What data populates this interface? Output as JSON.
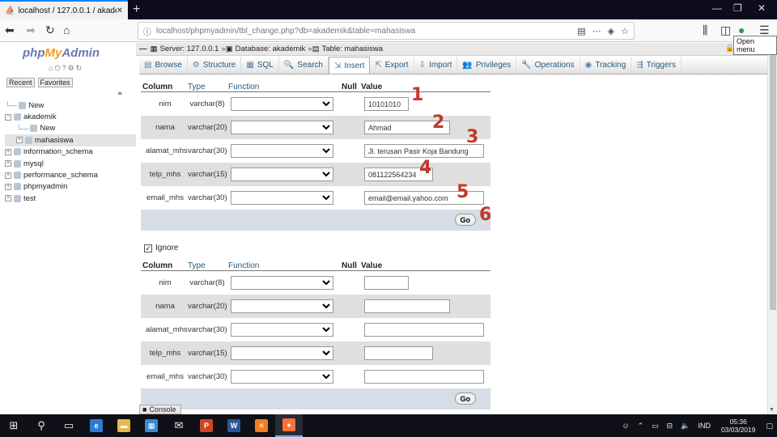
{
  "browser": {
    "tab_title": "localhost / 127.0.0.1 / akademik",
    "tab_close": "✕",
    "new_tab": "+",
    "url": "localhost/phpmyadmin/tbl_change.php?db=akademik&table=mahasiswa",
    "menu_tooltip": "Open menu"
  },
  "sidebar": {
    "logo_php": "php",
    "logo_my": "My",
    "logo_admin": "Admin",
    "tab_recent": "Recent",
    "tab_favorites": "Favorites",
    "tree": [
      {
        "label": "New",
        "level": 0,
        "toggle": ""
      },
      {
        "label": "akademik",
        "level": 0,
        "toggle": "−"
      },
      {
        "label": "New",
        "level": 1,
        "toggle": ""
      },
      {
        "label": "mahasiswa",
        "level": 1,
        "toggle": "+"
      },
      {
        "label": "information_schema",
        "level": 0,
        "toggle": "+"
      },
      {
        "label": "mysql",
        "level": 0,
        "toggle": "+"
      },
      {
        "label": "performance_schema",
        "level": 0,
        "toggle": "+"
      },
      {
        "label": "phpmyadmin",
        "level": 0,
        "toggle": "+"
      },
      {
        "label": "test",
        "level": 0,
        "toggle": "+"
      }
    ]
  },
  "breadcrumb": {
    "server": "Server: 127.0.0.1",
    "database": "Database: akademik",
    "table": "Table: mahasiswa"
  },
  "menu": [
    {
      "label": "Browse",
      "icon": "browse-icon",
      "glyph": "▤"
    },
    {
      "label": "Structure",
      "icon": "structure-icon",
      "glyph": "⚙"
    },
    {
      "label": "SQL",
      "icon": "sql-icon",
      "glyph": "▦"
    },
    {
      "label": "Search",
      "icon": "search-icon",
      "glyph": "🔍"
    },
    {
      "label": "Insert",
      "icon": "insert-icon",
      "glyph": "⇲"
    },
    {
      "label": "Export",
      "icon": "export-icon",
      "glyph": "⇱"
    },
    {
      "label": "Import",
      "icon": "import-icon",
      "glyph": "⇩"
    },
    {
      "label": "Privileges",
      "icon": "privileges-icon",
      "glyph": "👥"
    },
    {
      "label": "Operations",
      "icon": "operations-icon",
      "glyph": "🔧"
    },
    {
      "label": "Tracking",
      "icon": "tracking-icon",
      "glyph": "◉"
    },
    {
      "label": "Triggers",
      "icon": "triggers-icon",
      "glyph": "⇶"
    }
  ],
  "active_menu": "Insert",
  "table_headers": {
    "column": "Column",
    "type": "Type",
    "function": "Function",
    "null": "Null",
    "value": "Value"
  },
  "form1": {
    "rows": [
      {
        "column": "nim",
        "type": "varchar(8)",
        "value": "10101010"
      },
      {
        "column": "nama",
        "type": "varchar(20)",
        "value": "Ahmad"
      },
      {
        "column": "alamat_mhs",
        "type": "varchar(30)",
        "value": "Jl. terusan Pasir Koja Bandung"
      },
      {
        "column": "telp_mhs",
        "type": "varchar(15)",
        "value": "081122564234"
      },
      {
        "column": "email_mhs",
        "type": "varchar(30)",
        "value": "email@email.yahoo.com"
      }
    ],
    "go_label": "Go"
  },
  "annotations": [
    "1",
    "2",
    "3",
    "4",
    "5",
    "6"
  ],
  "ignore_label": "Ignore",
  "ignore_check": "✓",
  "form2": {
    "rows": [
      {
        "column": "nim",
        "type": "varchar(8)",
        "value": ""
      },
      {
        "column": "nama",
        "type": "varchar(20)",
        "value": ""
      },
      {
        "column": "alamat_mhs",
        "type": "varchar(30)",
        "value": ""
      },
      {
        "column": "telp_mhs",
        "type": "varchar(15)",
        "value": ""
      },
      {
        "column": "email_mhs",
        "type": "varchar(30)",
        "value": ""
      }
    ],
    "go_label": "Go"
  },
  "console_label": "Console",
  "taskbar": {
    "apps": [
      {
        "name": "start",
        "glyph": "⊞",
        "color": ""
      },
      {
        "name": "search",
        "glyph": "⚲",
        "color": ""
      },
      {
        "name": "task-view",
        "glyph": "▭",
        "color": ""
      },
      {
        "name": "edge",
        "glyph": "e",
        "color": "#2b7cd3"
      },
      {
        "name": "file-explorer",
        "glyph": "▬",
        "color": "#e8b84a"
      },
      {
        "name": "store",
        "glyph": "▦",
        "color": "#3a8ad4"
      },
      {
        "name": "mail",
        "glyph": "✉",
        "color": ""
      },
      {
        "name": "powerpoint",
        "glyph": "P",
        "color": "#d04423"
      },
      {
        "name": "word",
        "glyph": "W",
        "color": "#2b579a"
      },
      {
        "name": "xampp",
        "glyph": "✕",
        "color": "#f57c1f"
      },
      {
        "name": "firefox",
        "glyph": "●",
        "color": "#ff7139"
      }
    ],
    "lang": "IND",
    "time": "05:36",
    "date": "03/03/2019"
  }
}
